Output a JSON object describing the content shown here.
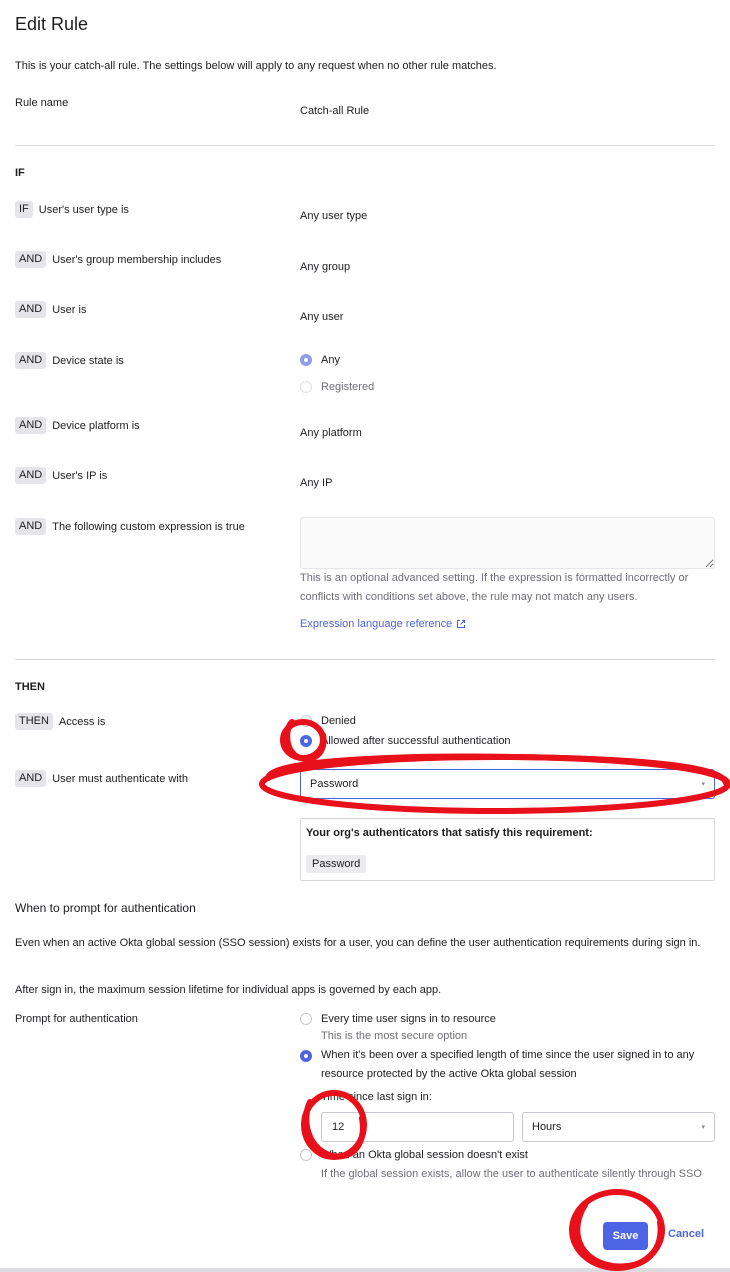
{
  "header": {
    "title": "Edit Rule",
    "description": "This is your catch-all rule. The settings below will apply to any request when no other rule matches."
  },
  "rule_name": {
    "label": "Rule name",
    "value": "Catch-all Rule"
  },
  "if_section": {
    "heading": "IF",
    "conditions": [
      {
        "badge": "IF",
        "label": "User's user type is",
        "value": "Any user type"
      },
      {
        "badge": "AND",
        "label": "User's group membership includes",
        "value": "Any group"
      },
      {
        "badge": "AND",
        "label": "User is",
        "value": "Any user"
      },
      {
        "badge": "AND",
        "label": "Device state is",
        "options": [
          "Any",
          "Registered"
        ],
        "selected": "Any"
      },
      {
        "badge": "AND",
        "label": "Device platform is",
        "value": "Any platform"
      },
      {
        "badge": "AND",
        "label": "User's IP is",
        "value": "Any IP"
      },
      {
        "badge": "AND",
        "label": "The following custom expression is true",
        "value": ""
      }
    ],
    "expression_hint": "This is an optional advanced setting. If the expression is formatted incorrectly or conflicts with conditions set above, the rule may not match any users.",
    "expression_link": "Expression language reference"
  },
  "then_section": {
    "heading": "THEN",
    "access": {
      "badge": "THEN",
      "label": "Access is",
      "options": [
        "Denied",
        "Allowed after successful authentication"
      ],
      "selected": "Allowed after successful authentication"
    },
    "authenticate": {
      "badge": "AND",
      "label": "User must authenticate with",
      "selected": "Password"
    },
    "authenticators_panel": {
      "heading": "Your org's authenticators that satisfy this requirement:",
      "items": [
        "Password"
      ]
    }
  },
  "prompt_section": {
    "heading": "When to prompt for authentication",
    "paragraph1": "Even when an active Okta global session (SSO session) exists for a user, you can define the user authentication requirements during sign in.",
    "paragraph2": "After sign in, the maximum session lifetime for individual apps is governed by each app.",
    "label": "Prompt for authentication",
    "options": [
      {
        "label": "Every time user signs in to resource",
        "hint": "This is the most secure option"
      },
      {
        "label": "When it's been over a specified length of time since the user signed in to any resource protected by the active Okta global session",
        "hint": ""
      },
      {
        "label": "When an Okta global session doesn't exist",
        "hint": "If the global session exists, allow the user to authenticate silently through SSO"
      }
    ],
    "selected_index": 1,
    "time_label": "Time since last sign in:",
    "time_value": "12",
    "time_unit": "Hours"
  },
  "footer": {
    "save_label": "Save",
    "cancel_label": "Cancel"
  },
  "colors": {
    "accent": "#4c64e6",
    "annotation": "#e8101a",
    "badge_bg": "#e5e5e9"
  }
}
